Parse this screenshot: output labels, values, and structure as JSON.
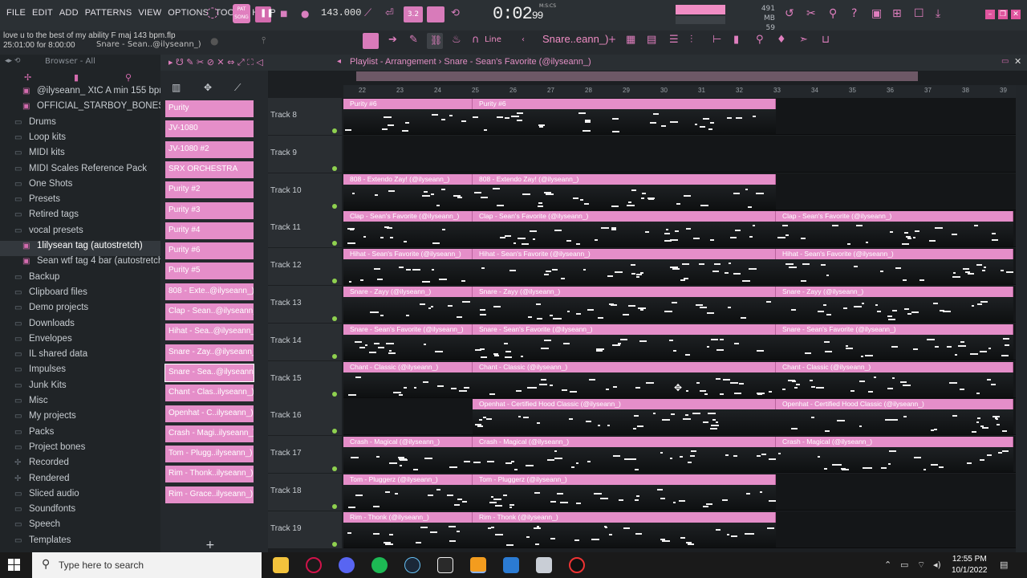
{
  "menu": [
    "FILE",
    "EDIT",
    "ADD",
    "PATTERNS",
    "VIEW",
    "OPTIONS",
    "TOOLS",
    "HELP"
  ],
  "transport": {
    "mode_label": "PAT",
    "mode_label2": "SONG",
    "tempo": "143.000",
    "time_main": "0:02",
    "time_sub": "99",
    "time_unit": "M:S:CS",
    "mem": "491 MB",
    "cpu": "59"
  },
  "hint": {
    "line1": "love u to the best of my ability F maj 143 bpm.flp",
    "line2": "25:01:00 for 8:00:00",
    "channel": "Snare - Sean..@ilyseann_)"
  },
  "toolbar": {
    "snap_mode": "Line",
    "pattern_selector": "Snare..eann_)"
  },
  "browser": {
    "title": "Browser - All",
    "items": [
      {
        "label": "@ilyseann_ XtC A min 155 bpm",
        "icon": "file-icon"
      },
      {
        "label": "OFFICIAL_STARBOY_BONES_808",
        "icon": "file-icon"
      },
      {
        "label": "Drums",
        "icon": "folder-icon"
      },
      {
        "label": "Loop kits",
        "icon": "folder-icon"
      },
      {
        "label": "MIDI kits",
        "icon": "folder-icon"
      },
      {
        "label": "MIDI Scales Reference Pack",
        "icon": "folder-icon"
      },
      {
        "label": "One Shots",
        "icon": "folder-icon"
      },
      {
        "label": "Presets",
        "icon": "folder-icon"
      },
      {
        "label": "Retired tags",
        "icon": "folder-icon"
      },
      {
        "label": "vocal presets",
        "icon": "folder-icon"
      },
      {
        "label": "1lilysean tag (autostretch)",
        "icon": "file-icon"
      },
      {
        "label": "Sean wtf tag 4 bar (autostretch)",
        "icon": "file-icon"
      },
      {
        "label": "Backup",
        "icon": "folder-icon"
      },
      {
        "label": "Clipboard files",
        "icon": "folder-icon"
      },
      {
        "label": "Demo projects",
        "icon": "folder-icon"
      },
      {
        "label": "Downloads",
        "icon": "folder-icon"
      },
      {
        "label": "Envelopes",
        "icon": "folder-icon"
      },
      {
        "label": "IL shared data",
        "icon": "folder-icon"
      },
      {
        "label": "Impulses",
        "icon": "folder-icon"
      },
      {
        "label": "Junk Kits",
        "icon": "folder-icon"
      },
      {
        "label": "Misc",
        "icon": "folder-icon"
      },
      {
        "label": "My projects",
        "icon": "folder-icon"
      },
      {
        "label": "Packs",
        "icon": "folder-icon"
      },
      {
        "label": "Project bones",
        "icon": "folder-icon"
      },
      {
        "label": "Recorded",
        "icon": "plus-icon"
      },
      {
        "label": "Rendered",
        "icon": "plus-icon"
      },
      {
        "label": "Sliced audio",
        "icon": "folder-icon"
      },
      {
        "label": "Soundfonts",
        "icon": "folder-icon"
      },
      {
        "label": "Speech",
        "icon": "folder-icon"
      },
      {
        "label": "Templates",
        "icon": "folder-icon"
      }
    ]
  },
  "patterns": [
    "Purity",
    "JV-1080",
    "JV-1080 #2",
    "SRX ORCHESTRA",
    "Purity #2",
    "Purity #3",
    "Purity #4",
    "Purity #6",
    "Purity #5",
    "808 - Exte..@ilyseann_)",
    "Clap - Sean..@ilyseann_)",
    "Hihat - Sea..@ilyseann_)",
    "Snare - Zay..@ilyseann_)",
    "Snare - Sea..@ilyseann_)",
    "Chant - Clas..ilyseann_)",
    "Openhat - C..ilyseann_)",
    "Crash - Magi..ilyseann_)",
    "Tom - Plugg..ilyseann_)",
    "Rim - Thonk..ilyseann_)",
    "Rim - Grace..ilyseann_)"
  ],
  "playlist": {
    "title": "Playlist - Arrangement",
    "pattern": "Snare - Sean's Favorite (@ilyseann_)",
    "ruler": [
      "22",
      "23",
      "24",
      "25",
      "26",
      "27",
      "28",
      "29",
      "30",
      "31",
      "32",
      "33",
      "34",
      "35",
      "36",
      "37",
      "38",
      "39"
    ],
    "tracks": [
      {
        "name": "Track 8",
        "clips": [
          [
            "Purity #6",
            0
          ],
          [
            "Purity #6",
            1
          ]
        ]
      },
      {
        "name": "Track 9",
        "clips": []
      },
      {
        "name": "Track 10",
        "clips": [
          [
            "808 - Extendo Zay! (@ilyseann_)",
            0
          ],
          [
            "808 - Extendo Zay! (@ilyseann_)",
            1
          ]
        ]
      },
      {
        "name": "Track 11",
        "clips": [
          [
            "Clap - Sean's Favorite (@ilyseann_)",
            0
          ],
          [
            "Clap - Sean's Favorite (@ilyseann_)",
            1
          ],
          [
            "Clap - Sean's Favorite (@ilyseann_)",
            2
          ]
        ]
      },
      {
        "name": "Track 12",
        "clips": [
          [
            "Hihat - Sean's Favorite (@ilyseann_)",
            0
          ],
          [
            "Hihat - Sean's Favorite (@ilyseann_)",
            1
          ],
          [
            "Hihat - Sean's Favorite (@ilyseann_)",
            2
          ]
        ]
      },
      {
        "name": "Track 13",
        "clips": [
          [
            "Snare - Zayy (@ilyseann_)",
            0
          ],
          [
            "Snare - Zayy (@ilyseann_)",
            1
          ],
          [
            "Snare - Zayy (@ilyseann_)",
            2
          ]
        ]
      },
      {
        "name": "Track 14",
        "clips": [
          [
            "Snare - Sean's Favorite (@ilyseann_)",
            0
          ],
          [
            "Snare - Sean's Favorite (@ilyseann_)",
            1
          ],
          [
            "Snare - Sean's Favorite (@ilyseann_)",
            2
          ]
        ]
      },
      {
        "name": "Track 15",
        "clips": [
          [
            "Chant - Classic (@ilyseann_)",
            0
          ],
          [
            "Chant - Classic (@ilyseann_)",
            1
          ],
          [
            "Chant - Classic (@ilyseann_)",
            2
          ]
        ]
      },
      {
        "name": "Track 16",
        "clips": [
          [
            "Openhat - Certified Hood Classic (@ilyseann_)",
            1
          ],
          [
            "Openhat - Certified Hood Classic (@ilyseann_)",
            2
          ]
        ]
      },
      {
        "name": "Track 17",
        "clips": [
          [
            "Crash - Magical (@ilyseann_)",
            0
          ],
          [
            "Crash - Magical (@ilyseann_)",
            1
          ],
          [
            "Crash - Magical (@ilyseann_)",
            2
          ]
        ]
      },
      {
        "name": "Track 18",
        "clips": [
          [
            "Tom - Pluggerz (@ilyseann_)",
            0
          ],
          [
            "Tom - Pluggerz (@ilyseann_)",
            1
          ]
        ]
      },
      {
        "name": "Track 19",
        "clips": [
          [
            "Rim - Thonk (@ilyseann_)",
            0
          ],
          [
            "Rim - Thonk (@ilyseann_)",
            1
          ]
        ]
      }
    ]
  },
  "taskbar": {
    "search_placeholder": "Type here to search",
    "time": "12:55 PM",
    "date": "10/1/2022"
  },
  "colors": {
    "accent": "#e58ec9",
    "background": "#1c1f22"
  }
}
